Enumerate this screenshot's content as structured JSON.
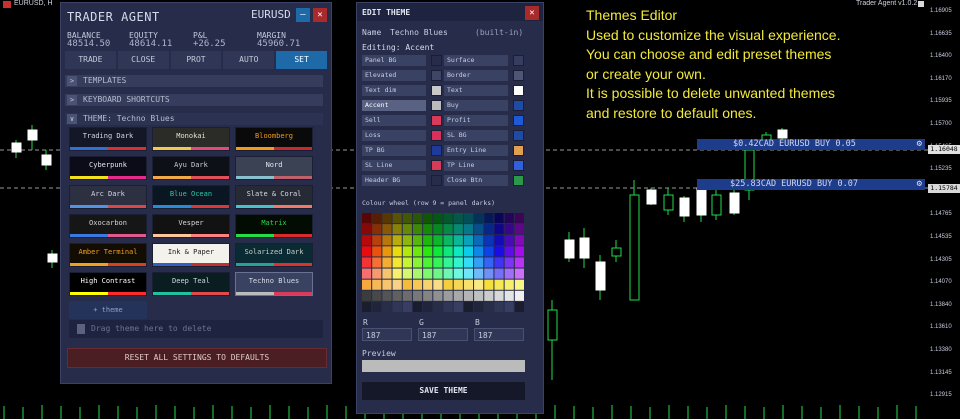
{
  "topbar": {
    "symbol": "EURUSD, H",
    "app_version": "Trader Agent v1.0.2"
  },
  "agent": {
    "title": "TRADER AGENT",
    "symbol": "EURUSD",
    "stats": [
      {
        "label": "BALANCE",
        "value": "48514.50"
      },
      {
        "label": "EQUITY",
        "value": "48614.11"
      },
      {
        "label": "P&L",
        "value": "+26.25"
      },
      {
        "label": "MARGIN",
        "value": "45960.71"
      }
    ],
    "tabs": [
      "TRADE",
      "CLOSE",
      "PROT",
      "AUTO",
      "SET"
    ],
    "sections": {
      "templates": "TEMPLATES",
      "shortcuts": "KEYBOARD SHORTCUTS",
      "theme": "THEME: Techno Blues"
    },
    "themes": [
      {
        "name": "Trading Dark",
        "bg": "#141826",
        "fg": "#d4d8e6",
        "sw": [
          "#2f6fd8",
          "#2f6fd8",
          "#d83030",
          "#d83030"
        ]
      },
      {
        "name": "Monokai",
        "bg": "#2b2b27",
        "fg": "#e4e2d4",
        "sw": [
          "#f2c94c",
          "#f2c94c",
          "#e34a7a",
          "#e34a7a"
        ]
      },
      {
        "name": "Bloomberg",
        "bg": "#0a0a0a",
        "fg": "#f29a1a",
        "sw": [
          "#f29a1a",
          "#f29a1a",
          "#c62a2a",
          "#c62a2a"
        ]
      },
      {
        "name": "Cyberpunk",
        "bg": "#0c0c18",
        "fg": "#e6e6ee",
        "sw": [
          "#f2e01e",
          "#f2e01e",
          "#e62a8a",
          "#e62a8a"
        ]
      },
      {
        "name": "Ayu Dark",
        "bg": "#0e1018",
        "fg": "#c8ccd8",
        "sw": [
          "#f0a848",
          "#f0a848",
          "#e0505a",
          "#e0505a"
        ]
      },
      {
        "name": "Nord",
        "bg": "#3a4254",
        "fg": "#e6e9f0",
        "sw": [
          "#88c0d0",
          "#88c0d0",
          "#bf616a",
          "#bf616a"
        ]
      },
      {
        "name": "Arc Dark",
        "bg": "#2c3040",
        "fg": "#d4d8e4",
        "sw": [
          "#5294e2",
          "#5294e2",
          "#d84848",
          "#d84848"
        ]
      },
      {
        "name": "Blue Ocean",
        "bg": "#0a1622",
        "fg": "#2ac8a8",
        "sw": [
          "#2a8ad8",
          "#2a8ad8",
          "#d83a3a",
          "#d83a3a"
        ]
      },
      {
        "name": "Slate & Coral",
        "bg": "#262a34",
        "fg": "#d8dce6",
        "sw": [
          "#4ac0c8",
          "#4ac0c8",
          "#f07a6a",
          "#f07a6a"
        ]
      },
      {
        "name": "Oxocarbon",
        "bg": "#161616",
        "fg": "#d4d4d4",
        "sw": [
          "#3a7ae0",
          "#3a7ae0",
          "#e05a8a",
          "#e05a8a"
        ]
      },
      {
        "name": "Vesper",
        "bg": "#121212",
        "fg": "#d8d8d8",
        "sw": [
          "#ffc799",
          "#ffc799",
          "#ff8080",
          "#ff8080"
        ]
      },
      {
        "name": "Matrix",
        "bg": "#020c02",
        "fg": "#22dd44",
        "sw": [
          "#22dd44",
          "#22dd44",
          "#d82a2a",
          "#d82a2a"
        ]
      },
      {
        "name": "Amber Terminal",
        "bg": "#120c02",
        "fg": "#f0a020",
        "sw": [
          "#f0a020",
          "#f0a020",
          "#d84020",
          "#d84020"
        ]
      },
      {
        "name": "Ink & Paper",
        "bg": "#f4f2ec",
        "fg": "#202020",
        "sw": [
          "#3060c0",
          "#3060c0",
          "#c03030",
          "#c03030"
        ]
      },
      {
        "name": "Solarized Dark",
        "bg": "#0a2a34",
        "fg": "#c8ccc4",
        "sw": [
          "#2aa198",
          "#2aa198",
          "#dc322f",
          "#dc322f"
        ]
      },
      {
        "name": "High Contrast",
        "bg": "#000000",
        "fg": "#ffffff",
        "sw": [
          "#ffff00",
          "#ffff00",
          "#ff2a2a",
          "#ff2a2a"
        ]
      },
      {
        "name": "Deep Teal",
        "bg": "#0a1e22",
        "fg": "#c8d8dc",
        "sw": [
          "#20c0a0",
          "#20c0a0",
          "#e04a4a",
          "#e04a4a"
        ]
      },
      {
        "name": "Techno Blues",
        "bg": "#3a4262",
        "fg": "#d8dcea",
        "sw": [
          "#bbbbbb",
          "#bbbbbb",
          "#d83a5a",
          "#d83a5a"
        ]
      }
    ],
    "add_theme": "+ theme",
    "drop_text": "Drag theme here to delete",
    "reset_label": "RESET ALL SETTINGS TO DEFAULTS"
  },
  "edit": {
    "title": "EDIT THEME",
    "name_label": "Name",
    "name_value": "Techno Blues",
    "name_note": "(built-in)",
    "editing_label": "Editing: Accent",
    "items": [
      {
        "label": "Panel BG",
        "color": "#262c4a"
      },
      {
        "label": "Surface",
        "color": "#363d5e"
      },
      {
        "label": "Elevated",
        "color": "#3e4668"
      },
      {
        "label": "Border",
        "color": "#4e5678"
      },
      {
        "label": "Text dim",
        "color": "#c8c8c8"
      },
      {
        "label": "Text",
        "color": "#ffffff"
      },
      {
        "label": "Accent",
        "color": "#bbbbbb",
        "selected": true
      },
      {
        "label": "Buy",
        "color": "#1e4aa8"
      },
      {
        "label": "Sell",
        "color": "#d83a5a"
      },
      {
        "label": "Profit",
        "color": "#1e5ad8"
      },
      {
        "label": "Loss",
        "color": "#d8305a"
      },
      {
        "label": "SL BG",
        "color": "#1e4aa8"
      },
      {
        "label": "TP BG",
        "color": "#1e3a9a"
      },
      {
        "label": "Entry Line",
        "color": "#e0a050"
      },
      {
        "label": "SL Line",
        "color": "#d83a5a"
      },
      {
        "label": "TP Line",
        "color": "#3060e0"
      },
      {
        "label": "Header BG",
        "color": "#262c4a"
      },
      {
        "label": "Close Btn",
        "color": "#2a9a4a"
      }
    ],
    "wheel_label": "Colour wheel  (row 9 = panel darks)",
    "rgb_labels": [
      "R",
      "G",
      "B"
    ],
    "rgb_values": [
      "187",
      "187",
      "187"
    ],
    "preview_label": "Preview",
    "preview_color": "#bbbbbb",
    "save_label": "SAVE THEME"
  },
  "annotation": [
    "Themes Editor",
    "Used to customize the visual experience.",
    "You can choose and edit preset themes",
    "or create your own.",
    "It is possible to delete unwanted themes",
    "and restore to default ones."
  ],
  "trades": [
    {
      "text": "$0.42CAD EURUSD  BUY 0.05"
    },
    {
      "text": "$25.83CAD EURUSD  BUY 0.07"
    }
  ],
  "price_labels": [
    "1.16905",
    "1.16635",
    "1.16400",
    "1.16170",
    "1.15935",
    "1.15700",
    "1.15465",
    "1.15235",
    "1.15000",
    "1.14765",
    "1.14535",
    "1.14305",
    "1.14070",
    "1.13840",
    "1.13610",
    "1.13380",
    "1.13145",
    "1.12915"
  ],
  "price_boxes": [
    "1.16048",
    "1.15784"
  ],
  "colors": {
    "panel": "#262c4a",
    "accent": "#1e6aa8",
    "bull": "#22dd44",
    "annotation": "#f2ea3a"
  }
}
